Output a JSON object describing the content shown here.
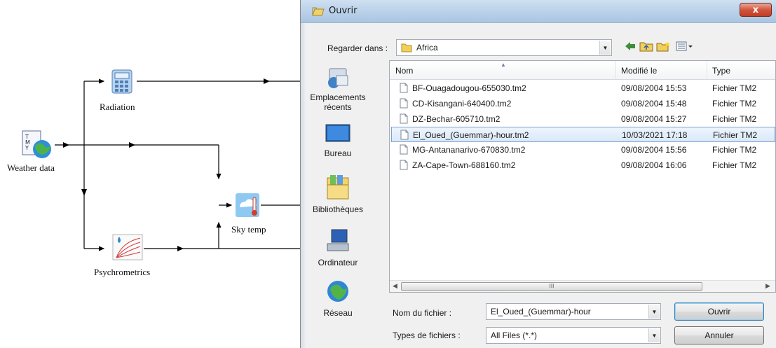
{
  "diagram": {
    "components": [
      {
        "id": "weather",
        "label": "Weather data",
        "icon": "weather-data-icon"
      },
      {
        "id": "radiation",
        "label": "Radiation",
        "icon": "calculator-icon"
      },
      {
        "id": "skytemp",
        "label": "Sky temp",
        "icon": "sky-temp-icon"
      },
      {
        "id": "psychro",
        "label": "Psychrometrics",
        "icon": "psychrometrics-icon"
      }
    ],
    "weather_icon_text": "TMY2"
  },
  "dialog": {
    "title": "Ouvrir",
    "close_label": "x",
    "look_in_label": "Regarder dans :",
    "look_in_value": "Africa",
    "places": [
      {
        "label_line1": "Emplacements",
        "label_line2": "récents",
        "icon": "recent-places-icon"
      },
      {
        "label_line1": "Bureau",
        "label_line2": "",
        "icon": "desktop-icon"
      },
      {
        "label_line1": "Bibliothèques",
        "label_line2": "",
        "icon": "libraries-icon"
      },
      {
        "label_line1": "Ordinateur",
        "label_line2": "",
        "icon": "computer-icon"
      },
      {
        "label_line1": "Réseau",
        "label_line2": "",
        "icon": "network-icon"
      }
    ],
    "columns": {
      "name": "Nom",
      "modified": "Modifié le",
      "type": "Type"
    },
    "files": [
      {
        "name": "BF-Ouagadougou-655030.tm2",
        "modified": "09/08/2004 15:53",
        "type": "Fichier TM2",
        "selected": false
      },
      {
        "name": "CD-Kisangani-640400.tm2",
        "modified": "09/08/2004 15:48",
        "type": "Fichier TM2",
        "selected": false
      },
      {
        "name": "DZ-Bechar-605710.tm2",
        "modified": "09/08/2004 15:27",
        "type": "Fichier TM2",
        "selected": false
      },
      {
        "name": "El_Oued_(Guemmar)-hour.tm2",
        "modified": "10/03/2021 17:18",
        "type": "Fichier TM2",
        "selected": true
      },
      {
        "name": "MG-Antananarivo-670830.tm2",
        "modified": "09/08/2004 15:56",
        "type": "Fichier TM2",
        "selected": false
      },
      {
        "name": "ZA-Cape-Town-688160.tm2",
        "modified": "09/08/2004 16:06",
        "type": "Fichier TM2",
        "selected": false
      }
    ],
    "scroll_grip": "III",
    "filename_label": "Nom du fichier :",
    "filename_value": "El_Oued_(Guemmar)-hour",
    "filetype_label": "Types de fichiers :",
    "filetype_value": "All Files (*.*)",
    "open_label": "Ouvrir",
    "cancel_label": "Annuler"
  }
}
